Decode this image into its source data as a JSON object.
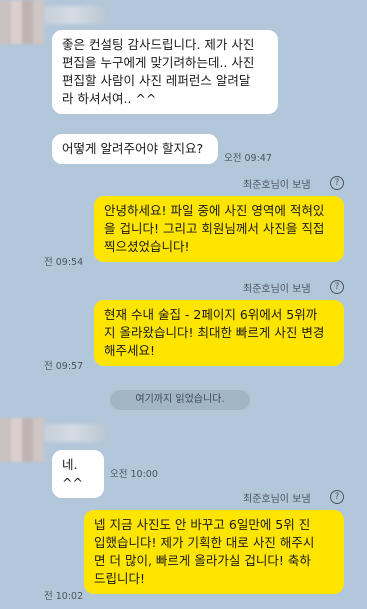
{
  "messages": [
    {
      "text": "좋은 컨설팅 감사드립니다. 제가 사진\n편집을 누구에게 맞기려하는데.. 사진\n편집할 사람이 사진 레퍼런스 알려달\n라 하셔서여.. ^^"
    },
    {
      "text": "어떻게 알려주어야 할지요?",
      "time": "오전 09:47"
    },
    {
      "sender": "최준호님이 보냄",
      "text": "안녕하세요! 파일 중에 사진 영역에 적혀있\n을 겁니다! 그리고 회원님께서 사진을 직접\n찍으셨었습니다!",
      "time": "전 09:54"
    },
    {
      "sender": "최준호님이 보냄",
      "text": "현재 수내 술집 - 2페이지 6위에서 5위까\n지 올라왔습니다! 최대한 빠르게 사진 변경\n해주세요!",
      "time": "전 09:57"
    },
    {
      "text": "네. ^^",
      "time": "오전 10:00"
    },
    {
      "sender": "최준호님이 보냄",
      "text": "넵 지금 사진도 안 바꾸고 6일만에 5위 진\n입했습니다! 제가 기획한 대로 사진 해주시\n면 더 많이, 빠르게 올라가실 겁니다! 축하\n드립니다!",
      "time": "전 10:02"
    }
  ],
  "divider": "여기까지 읽었습니다.",
  "help_glyph": "?"
}
